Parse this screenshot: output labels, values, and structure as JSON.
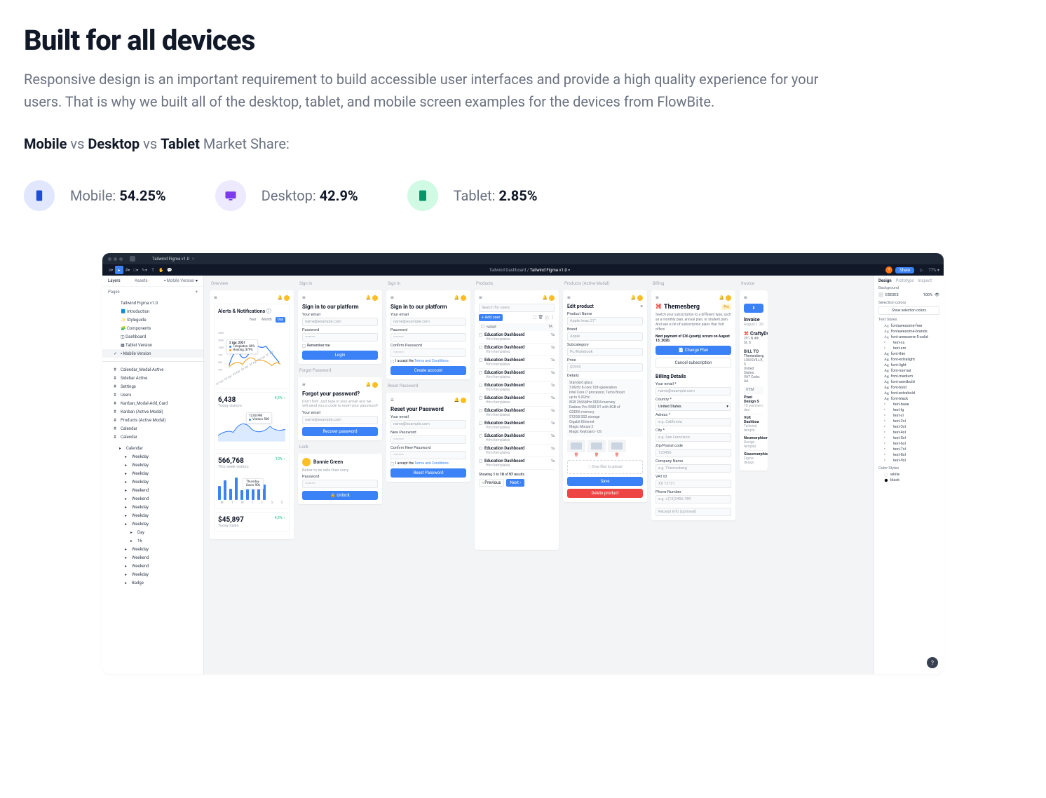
{
  "hero": {
    "title": "Built for all devices",
    "subtitle": "Responsive design is an important requirement to build accessible user interfaces and provide a high quality experience for your users. That is why we built all of the desktop, tablet, and mobile screen examples for the devices from FlowBite.",
    "share_prefix": "Mobile",
    "share_vs1": " vs ",
    "share_desktop": "Desktop",
    "share_vs2": " vs ",
    "share_tablet": "Tablet",
    "share_suffix": " Market Share:"
  },
  "stats": {
    "mobile_label": "Mobile: ",
    "mobile_value": "54.25%",
    "desktop_label": "Desktop: ",
    "desktop_value": "42.9%",
    "tablet_label": "Tablet: ",
    "tablet_value": "2.85%"
  },
  "figma": {
    "file_tab": "Tailwind Figma v1.0",
    "breadcrumb_left": "Tailwind Dashboard",
    "breadcrumb_right": "Tailwind Figma v1.0",
    "share": "Share",
    "zoom": "77%",
    "avatar_initial": "T"
  },
  "left_panel": {
    "tab_layers": "Layers",
    "tab_assets": "Assets",
    "mobile_version": "Mobile Version",
    "pages": "Pages",
    "plus": "+",
    "items": [
      "Tailwind Figma v1.0",
      "Introduction",
      "Styleguide",
      "Components",
      "Dashboard",
      "Tablet Version",
      "Mobile Version"
    ],
    "layers": [
      "Calendar_Modal-Active",
      "Sidebar Active",
      "Settings",
      "Users",
      "Kanban_Modal-Add_Card",
      "Kanban (Active Modal)",
      "Products (Active Modal)",
      "Calendar",
      "Calendar"
    ],
    "calendar_tree": {
      "root": "Calendar",
      "weekday": "Weekday",
      "weekend": "Weekend",
      "day": "Day",
      "day_num": "16",
      "badge": "Badge"
    }
  },
  "overview": {
    "label": "Overview",
    "alerts_title": "Alerts & Notifications",
    "seg": [
      "Year",
      "Month",
      "Day"
    ],
    "y_axis": [
      "250K",
      "200K",
      "150K",
      "125.",
      "80K",
      "40K",
      "0K"
    ],
    "x_axis": [
      "01 Apr",
      "02 Apr",
      "03 Apr",
      "04 Apr",
      "05 Apr",
      "06 Apr",
      "07 Apr"
    ],
    "tooltip": {
      "date": "2 Apr, 2021",
      "lines": [
        "Templates: 89%",
        "Hosting: $79%"
      ]
    },
    "visitors_num": "6,438",
    "visitors_label": "Today visitors",
    "visitors_pct": "4,3% ↑",
    "mini_tip_time": "12:00 PM",
    "mini_tip_val": "Visitors 500",
    "week_num": "566,768",
    "week_label": "This week visitors",
    "week_pct": "10% ↑",
    "bar_days": [
      "M",
      "T",
      "W",
      "T",
      "F",
      "S",
      "S"
    ],
    "bar_tip_day": "Thursday",
    "bar_tip_val": "Users 90k",
    "sales_num": "$45,897",
    "sales_label": "Today Sales",
    "sales_pct": "4,3% ↑"
  },
  "signin": {
    "label": "Sign In",
    "title": "Sign in to our platform",
    "email_lbl": "Your email",
    "email_ph": "name@example.com",
    "pw_lbl": "Password",
    "pw_ph": "••••••••",
    "remember": "Remember me",
    "login_btn": "Login",
    "confirm_lbl": "Confirm Password",
    "terms_prefix": "I accept the ",
    "terms_link": "Terms and Conditions",
    "create_btn": "Create account",
    "forgot_label": "Forgot Password",
    "forgot_title": "Forgot your password?",
    "forgot_desc": "Don't fret! Just type in your email and we will send you a code to reset your password!",
    "recover_btn": "Recover password",
    "lock_label": "Lock",
    "lock_name": "Bonnie Green",
    "lock_sub": "Better to be safe than sorry.",
    "unlock_btn": "Unlock",
    "reset_label": "Reset Password",
    "reset_title": "Reset your Password",
    "newpw_lbl": "New Password",
    "confirm_new_lbl": "Confirm New Password",
    "reset_btn": "Reset Password"
  },
  "products": {
    "label": "Products",
    "search_ph": "Search for users",
    "add_user": "Add user",
    "col_name": "NAME",
    "col_tag": "Ta",
    "row_title": "Education Dashboard",
    "row_sub": "Html templates",
    "showing": "Showing 1 to 10 of 97 results",
    "prev": "Previous",
    "next": "Next"
  },
  "products_modal": {
    "label": "Products (Active Modal)",
    "title": "Edit product",
    "name_lbl": "Product Name",
    "name_val": "Apple Imac 27\"",
    "brand_lbl": "Brand",
    "brand_val": "Apple",
    "subcat_lbl": "Subcategory",
    "subcat_val": "Pc/Notebook",
    "price_lbl": "Price",
    "price_val": "$2999",
    "details_lbl": "Details",
    "details_lines": [
      "Standard glass",
      "3.8GHz 8-core 10th-generation",
      "Intel Core i7 processor, Turbo Boost",
      "up to 5.0GHz",
      "8GB 2666MHz DDR4 memory",
      "Radeon Pro 5500 XT with 8GB of",
      "GDDR6 memory",
      "512GB SSD storage",
      "Gigabit Ethernet",
      "Magic Mouse 2",
      "Magic Keyboard - US"
    ],
    "dropzone": "Drop files to upload",
    "save": "Save",
    "delete": "Delete product"
  },
  "billing": {
    "label": "Billing",
    "brand": "Themesberg",
    "pro": "Pro",
    "desc": "Switch your subscription to a different type, such as a monthly plan, annual plan, or student plan. And see a list of subscription plans that Volt offers",
    "next_pay": "Next payment of $36 (yearly) occurs on August 13, 2020.",
    "change_plan": "Change Plan",
    "cancel": "Cancel subscription",
    "details_title": "Billing Details",
    "email_lbl": "Your email *",
    "email_ph": "name@example.com",
    "country_lbl": "Country *",
    "country_val": "United States",
    "address_lbl": "Adress *",
    "address_ph": "e.g. California",
    "city_lbl": "City *",
    "city_ph": "e.g. San Francisco",
    "zip_lbl": "Zip/Postal code",
    "zip_val": "123456",
    "company_lbl": "Company Name",
    "company_ph": "e.g. Themesberg",
    "vat_lbl": "VAT ID",
    "vat_val": "XX 12121",
    "phone_lbl": "Phone Number",
    "phone_ph": "e.g. +(12)3456 789",
    "receipt_ph": "Receipt Info (optional)"
  },
  "invoice": {
    "label": "Invoice",
    "btn": "...",
    "title": "Invoice",
    "date": "August 1, 20",
    "brand": "CraftyDwar",
    "addr": "291 N 4th St, S",
    "billto": "BILL TO",
    "to_name": "Themesberg",
    "to_addr1": "LOUISVILLE, S",
    "to_addr2": "United States",
    "to_vat": "VAT Code: AA",
    "item": "ITEM",
    "rows": [
      {
        "t": "Pixel Design S",
        "s": "10 premium des"
      },
      {
        "t": "Volt Dashboa",
        "s": "Tailwind templa"
      },
      {
        "t": "Neumorphism",
        "s": "Design templat"
      },
      {
        "t": "Glassmorphis",
        "s": "Figma design"
      }
    ]
  },
  "right_panel": {
    "tabs": [
      "Design",
      "Prototype",
      "Inspect"
    ],
    "bg": "Background",
    "bg_val": "E5E5E5",
    "bg_pct": "100%",
    "sel_colors": "Selection colors",
    "show_sel": "Show selection colors",
    "text_styles": "Text Styles",
    "fonts": [
      "fontawesome-free",
      "fontawesome-brands",
      "font-awesome-5-solid"
    ],
    "sizes": [
      "text-xs",
      "text-sm",
      "font-thin",
      "font-extralight",
      "font-light",
      "font-normal",
      "font-medium",
      "font-semibold",
      "font-bold",
      "font-extrabold",
      "font-black",
      "text-base",
      "text-lg",
      "text-xl",
      "text-2xl",
      "text-3xl",
      "text-4xl",
      "text-5xl",
      "text-6xl",
      "text-7xl",
      "text-8xl",
      "text-9xl"
    ],
    "color_styles": "Color Styles",
    "colors": [
      "white",
      "black"
    ]
  }
}
